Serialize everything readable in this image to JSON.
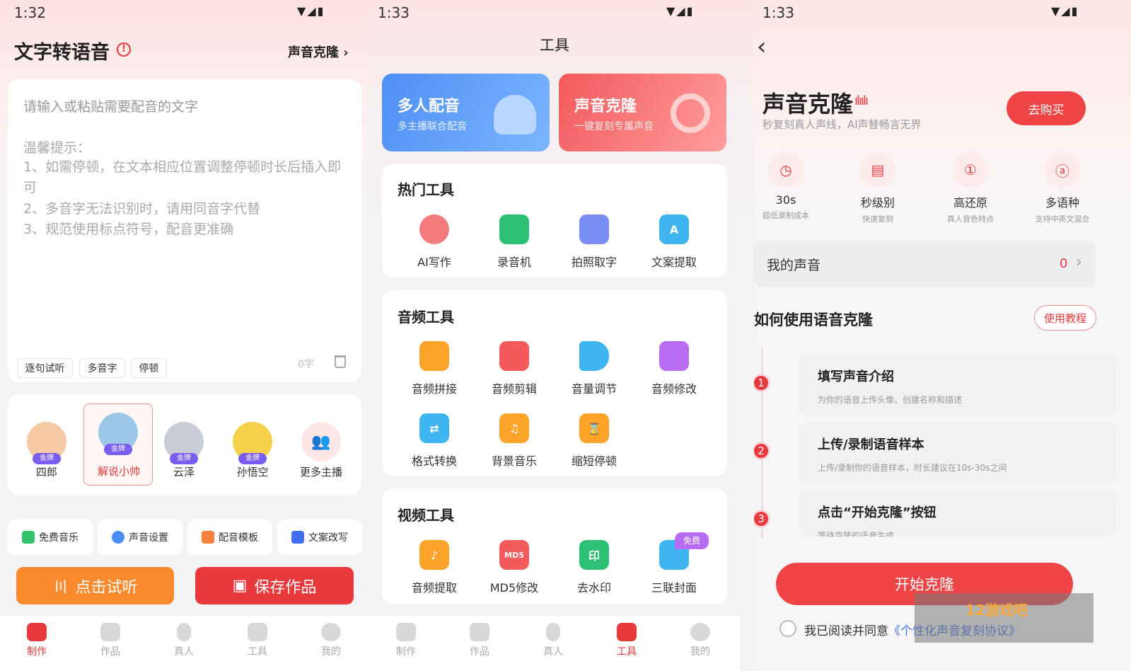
{
  "panel1": {
    "time": "1:32",
    "title": "文字转语音",
    "clone_link": "声音克隆",
    "placeholder": "请输入或粘贴需要配音的文字",
    "tips_title": "温馨提示：",
    "tip1": "1、如需停顿，在文本相应位置调整停顿时长后插入即可",
    "tip2": "2、多音字无法识别时，请用同音字代替",
    "tip3": "3、规范使用标点符号，配音更准确",
    "chips": [
      "逐句试听",
      "多音字",
      "停顿"
    ],
    "char_count": "0字",
    "gold_tag": "金牌",
    "anchors": [
      "四郎",
      "解说小帅",
      "云泽",
      "孙悟空",
      "更多主播"
    ],
    "quick": [
      "免费音乐",
      "声音设置",
      "配音模板",
      "文案改写"
    ],
    "listen_btn": "点击试听",
    "save_btn": "保存作品",
    "nav": [
      "制作",
      "作品",
      "真人",
      "工具",
      "我的"
    ]
  },
  "panel2": {
    "time": "1:33",
    "title": "工具",
    "banner1_title": "多人配音",
    "banner1_sub": "多主播联合配音",
    "banner2_title": "声音克隆",
    "banner2_sub": "一键复刻专属声音",
    "hot_title": "热门工具",
    "hot": [
      "AI写作",
      "录音机",
      "拍照取字",
      "文案提取"
    ],
    "audio_title": "音频工具",
    "audio": [
      "音频拼接",
      "音频剪辑",
      "音量调节",
      "音频修改",
      "格式转换",
      "背景音乐",
      "缩短停顿"
    ],
    "video_title": "视频工具",
    "video": [
      "音频提取",
      "MD5修改",
      "去水印",
      "三联封面"
    ],
    "free_badge": "免费",
    "md5_icon_text": "MD5",
    "watermark_icon_text": "印",
    "nav": [
      "制作",
      "作品",
      "真人",
      "工具",
      "我的"
    ]
  },
  "panel3": {
    "time": "1:33",
    "title": "声音克隆",
    "subtitle": "秒复刻真人声线，AI声替畅言无界",
    "buy_btn": "去购买",
    "features": [
      {
        "main": "30s",
        "sub": "超低录制成本"
      },
      {
        "main": "秒级别",
        "sub": "快速复刻"
      },
      {
        "main": "高还原",
        "sub": "真人音色特点"
      },
      {
        "main": "多语种",
        "sub": "支持中英文混合"
      }
    ],
    "my_voice": "我的声音",
    "my_voice_count": "0",
    "howto_title": "如何使用语音克隆",
    "tutorial_btn": "使用教程",
    "steps": [
      {
        "num": "1",
        "title": "填写声音介绍",
        "desc": "为你的语音上传头像、创建名称和描述"
      },
      {
        "num": "2",
        "title": "上传/录制语音样本",
        "desc": "上传/录制你的语音样本，时长建议在10s-30s之间"
      },
      {
        "num": "3",
        "title": "点击“开始克隆”按钮",
        "desc": "等待克隆的语音生成"
      }
    ],
    "start_btn": "开始克隆",
    "agree_text": "我已阅读并同意",
    "agree_link": "《个性化声音复刻协议》",
    "watermark": "12游戏吧"
  },
  "colors": {
    "accent": "#e8393c",
    "orange": "#fb8a2e",
    "blue": "#4a8ef2"
  }
}
